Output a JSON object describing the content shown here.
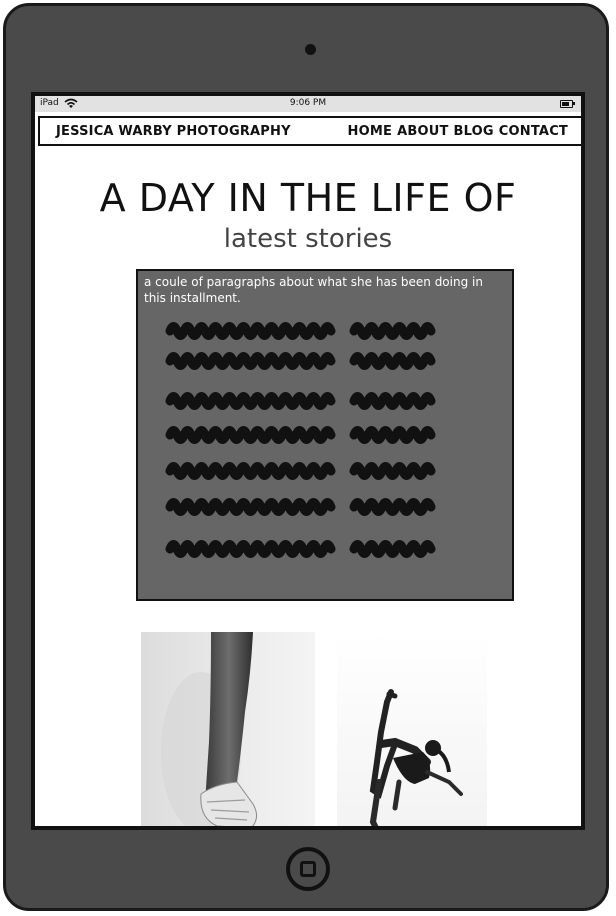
{
  "device": {
    "name": "iPad"
  },
  "status_bar": {
    "carrier": "iPad",
    "time": "9:06 PM"
  },
  "navbar": {
    "brand": "JESSICA WARBY PHOTOGRAPHY",
    "links": [
      "HOME",
      "ABOUT",
      "BLOG",
      "CONTACT"
    ]
  },
  "main": {
    "title": "A DAY IN THE LIFE OF",
    "subtitle": "latest stories",
    "story": {
      "text": "a coule of paragraphs about what she has been doing in this installment."
    }
  },
  "photos": [
    {
      "name": "ballet-leg-photo"
    },
    {
      "name": "dancer-kick-photo"
    }
  ],
  "colors": {
    "device_body": "#4a4a4a",
    "story_box": "#666666",
    "text_dark": "#111111"
  }
}
